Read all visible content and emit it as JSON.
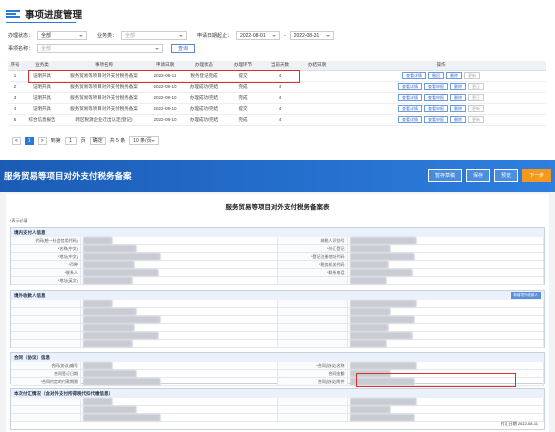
{
  "page": {
    "title": "事项进度管理"
  },
  "filters": {
    "status_label": "办理状态：",
    "status_value": "全部",
    "category_label": "业务类：",
    "category_value": "全部",
    "date_label": "申请日期起止：",
    "date_from": "2022-08-01",
    "date_to": "2022-08-31",
    "name_label": "事项名称：",
    "name_value": "全部",
    "query_button": "查询"
  },
  "table": {
    "columns": [
      "序号",
      "业务类",
      "事项名称",
      "申请日期",
      "办理状态",
      "办理环节",
      "当前天数",
      "办结日期",
      "操作"
    ],
    "rows": [
      {
        "no": "1",
        "cat": "证明开具",
        "name": "服务贸易等项目对外支付税务备案",
        "date": "2022-08-11",
        "status": "税务登记完成",
        "step": "提交",
        "days": "4",
        "done": "",
        "ops": [
          "查看详情",
          "撤回",
          "删除",
          "更新"
        ]
      },
      {
        "no": "2",
        "cat": "证明开具",
        "name": "服务贸易等项目对外支付税务备案",
        "date": "2022-08-10",
        "status": "办理成功/完结",
        "step": "完成",
        "days": "4",
        "done": "",
        "ops": [
          "查看详情",
          "查看申报",
          "删除",
          "更正"
        ]
      },
      {
        "no": "3",
        "cat": "证明开具",
        "name": "服务贸易等项目对外支付税务备案",
        "date": "2022-08-10",
        "status": "办理成功/完结",
        "step": "完成",
        "days": "4",
        "done": "",
        "ops": [
          "查看详情",
          "查看申报",
          "删除",
          "更正"
        ]
      },
      {
        "no": "4",
        "cat": "证明开具",
        "name": "服务贸易等项目对外支付税务备案",
        "date": "2022-08-10",
        "status": "办理成功/完结",
        "step": "提交",
        "days": "4",
        "done": "",
        "ops": [
          "查看详情",
          "查看申报",
          "删除",
          "更新"
        ]
      },
      {
        "no": "5",
        "cat": "综合信息报告",
        "name": "跨区税源企业迁出认定(登记)",
        "date": "2022-08-10",
        "status": "办理成功/完结",
        "step": "完成",
        "days": "4",
        "done": "",
        "ops": [
          "查看详情",
          "查看申报",
          "删除",
          "更新"
        ]
      }
    ]
  },
  "pager": {
    "prev": "<",
    "page": "1",
    "next": ">",
    "goto_label": "到第",
    "goto_value": "1",
    "page_unit": "页",
    "confirm": "确定",
    "total": "共 5 条",
    "size": "10 条/页"
  },
  "form": {
    "bar_title": "服务贸易等项目对外支付税务备案",
    "buttons": [
      "暂存草稿",
      "保存",
      "预览",
      "下一步"
    ],
    "title": "服务贸易等项目对外支付税务备案表",
    "hint": "*表示必填",
    "section1": "境内支付人信息",
    "section1_fields": [
      "代码(统一社会信用代码)",
      "纳税人识别号",
      "*名称(中文)",
      "*外汇登记",
      "*地址(中文)",
      "*登记注册地址代码",
      "*币种",
      "*税务机关代码",
      "*联系人",
      "*联系电话",
      "*地址(英文)"
    ],
    "section2": "境外收款人信息",
    "section2_btn": "新增境外收款人",
    "section3": "合同（协议）信息",
    "section3_fields": [
      "合同(协议)编号",
      "*合同(协议)名称",
      "合同签订日期",
      "合同金额",
      "*合同约定的付款期限",
      "合同(协议)附件"
    ],
    "section4": "本次付汇情况（含对外支付所得税代扣代缴信息）",
    "footer_date": "2022-08-11",
    "footer_date_label": "付汇日期"
  }
}
